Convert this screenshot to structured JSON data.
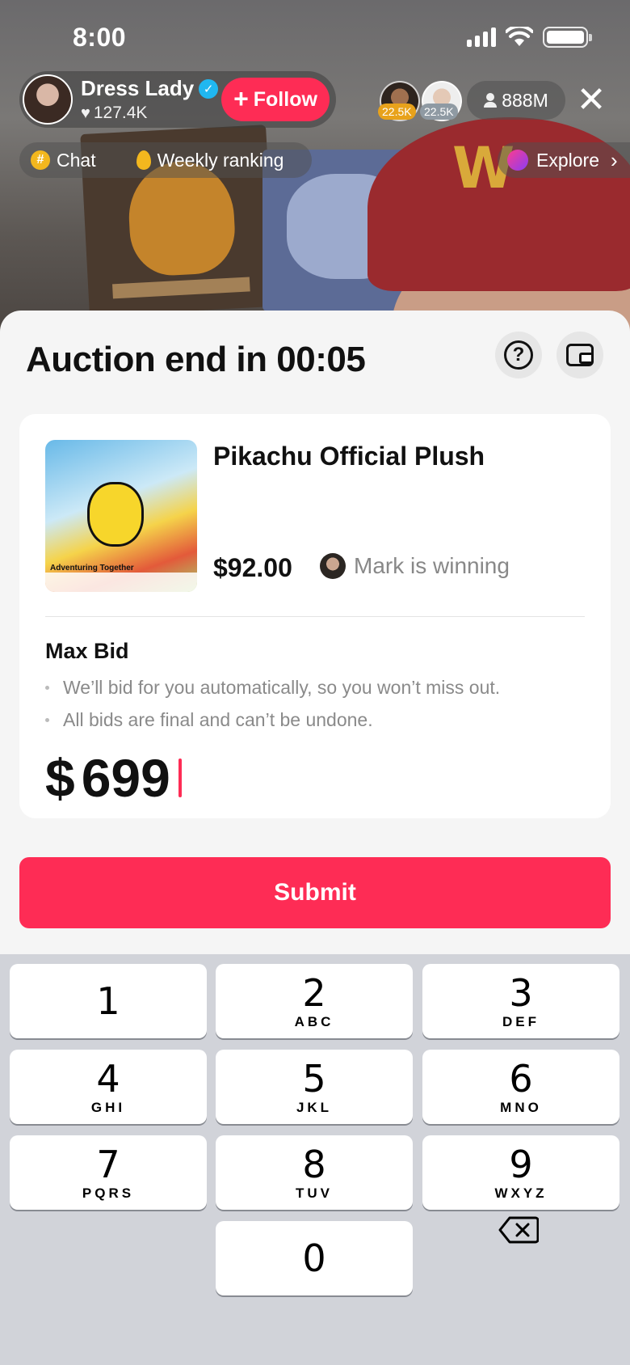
{
  "status_bar": {
    "time": "8:00"
  },
  "host": {
    "name": "Dress Lady",
    "likes": "127.4K",
    "follow_label": "Follow"
  },
  "viewers": {
    "top1_badge": "22.5K",
    "top2_badge": "22.5K",
    "count": "888M"
  },
  "subnav": {
    "chat_label": "Chat",
    "ranking_label": "Weekly ranking",
    "explore_label": "Explore"
  },
  "sheet": {
    "title": "Auction end in 00:05"
  },
  "product": {
    "image_caption": "Adventuring Together",
    "title": "Pikachu Official Plush",
    "price": "$92.00",
    "winner_text": "Mark is winning"
  },
  "max_bid": {
    "label": "Max Bid",
    "bullets": [
      "We’ll bid for you automatically, so you won’t miss out.",
      "All bids are final and can’t be undone."
    ],
    "currency": "$",
    "amount": "699"
  },
  "submit_label": "Submit",
  "keypad": {
    "keys": [
      {
        "digit": "1",
        "letters": ""
      },
      {
        "digit": "2",
        "letters": "ABC"
      },
      {
        "digit": "3",
        "letters": "DEF"
      },
      {
        "digit": "4",
        "letters": "GHI"
      },
      {
        "digit": "5",
        "letters": "JKL"
      },
      {
        "digit": "6",
        "letters": "MNO"
      },
      {
        "digit": "7",
        "letters": "PQRS"
      },
      {
        "digit": "8",
        "letters": "TUV"
      },
      {
        "digit": "9",
        "letters": "WXYZ"
      },
      {
        "digit": "0",
        "letters": ""
      }
    ]
  },
  "colors": {
    "accent": "#fe2c55",
    "verified": "#20b7f0",
    "keypad_bg": "#d1d3d9",
    "sheet_bg": "#f5f5f5"
  },
  "icons": [
    "signal-icon",
    "wifi-icon",
    "battery-icon",
    "verified-icon",
    "heart-icon",
    "person-icon",
    "close-icon",
    "hash-icon",
    "flame-icon",
    "planet-icon",
    "chevron-right-icon",
    "help-icon",
    "wallet-icon",
    "backspace-icon"
  ]
}
